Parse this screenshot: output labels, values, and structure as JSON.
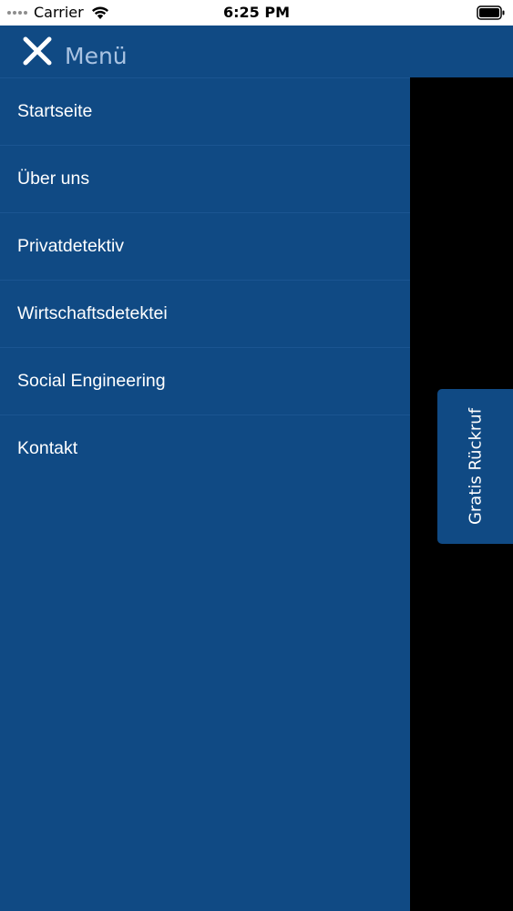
{
  "status_bar": {
    "carrier": "Carrier",
    "time": "6:25 PM",
    "wifi_icon": "wifi-icon",
    "battery_icon": "battery-icon"
  },
  "drawer": {
    "close_icon": "close-icon",
    "title": "Menü",
    "items": [
      {
        "label": "Startseite"
      },
      {
        "label": "Über uns"
      },
      {
        "label": "Privatdetektiv"
      },
      {
        "label": "Wirtschaftsdetektei"
      },
      {
        "label": "Social Engineering"
      },
      {
        "label": "Kontakt"
      }
    ]
  },
  "callback": {
    "label": "Gratis Rückruf"
  },
  "colors": {
    "primary": "#104a84",
    "title_text": "#a9c3e2",
    "divider": "#1b5591",
    "overlay": "#000000"
  }
}
